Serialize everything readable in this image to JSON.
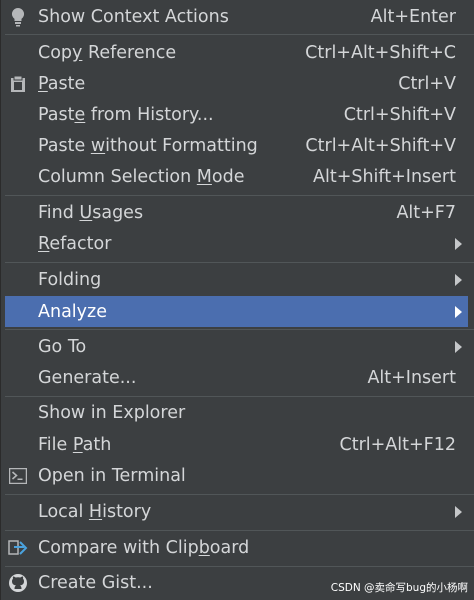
{
  "menu": {
    "items": [
      {
        "label": "Show Context Actions",
        "shortcut": "Alt+Enter",
        "icon": "lightbulb-icon"
      },
      {
        "label_pre": "Cop",
        "label_u": "y",
        "label_post": " Reference",
        "shortcut": "Ctrl+Alt+Shift+C"
      },
      {
        "label_pre": "",
        "label_u": "P",
        "label_post": "aste",
        "shortcut": "Ctrl+V",
        "icon": "clipboard-icon"
      },
      {
        "label_pre": "Past",
        "label_u": "e",
        "label_post": " from History...",
        "shortcut": "Ctrl+Shift+V"
      },
      {
        "label_pre": "Paste ",
        "label_u": "w",
        "label_post": "ithout Formatting",
        "shortcut": "Ctrl+Alt+Shift+V"
      },
      {
        "label_pre": "Column Selection ",
        "label_u": "M",
        "label_post": "ode",
        "shortcut": "Alt+Shift+Insert"
      },
      {
        "label_pre": "Find ",
        "label_u": "U",
        "label_post": "sages",
        "shortcut": "Alt+F7"
      },
      {
        "label_pre": "",
        "label_u": "R",
        "label_post": "efactor",
        "submenu": true
      },
      {
        "label": "Folding",
        "submenu": true
      },
      {
        "label": "Analyze",
        "submenu": true,
        "selected": true
      },
      {
        "label": "Go To",
        "submenu": true
      },
      {
        "label": "Generate...",
        "shortcut": "Alt+Insert"
      },
      {
        "label": "Show in Explorer"
      },
      {
        "label_pre": "File ",
        "label_u": "P",
        "label_post": "ath",
        "shortcut": "Ctrl+Alt+F12"
      },
      {
        "label": "Open in Terminal",
        "icon": "terminal-icon"
      },
      {
        "label_pre": "Local ",
        "label_u": "H",
        "label_post": "istory",
        "submenu": true
      },
      {
        "label_pre": "Compare with Clip",
        "label_u": "b",
        "label_post": "oard",
        "icon": "compare-icon"
      },
      {
        "label": "Create Gist...",
        "icon": "github-icon"
      }
    ]
  },
  "watermark": "CSDN @卖命写bug的小杨啊",
  "colors": {
    "background": "#3c3f41",
    "selected": "#4b6eaf",
    "text": "#d4d6d8",
    "separator": "#515658"
  }
}
